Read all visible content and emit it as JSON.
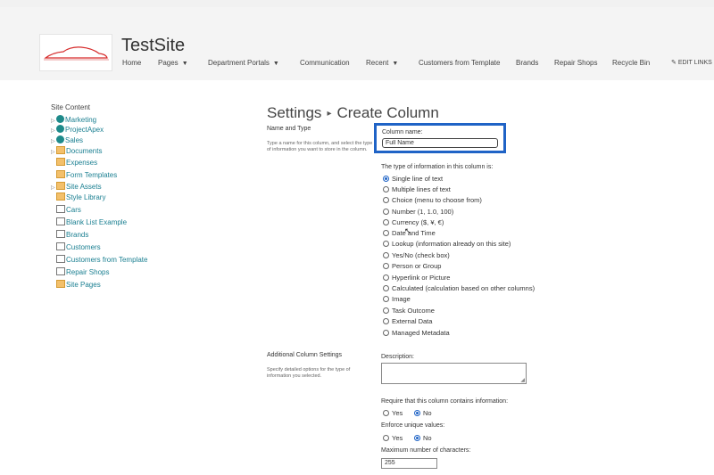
{
  "site": {
    "title": "TestSite"
  },
  "topnav": {
    "items": [
      {
        "label": "Home"
      },
      {
        "label": "Pages",
        "caret": "▼"
      },
      {
        "label": "Department Portals",
        "caret": "▼"
      },
      {
        "label": "Communication"
      },
      {
        "label": "Recent",
        "caret": "▼"
      },
      {
        "label": "Customers from Template"
      },
      {
        "label": "Brands"
      },
      {
        "label": "Repair Shops"
      },
      {
        "label": "Recycle Bin"
      }
    ],
    "edit_links": "EDIT LINKS"
  },
  "leftnav": {
    "heading": "Site Content",
    "items": [
      {
        "label": "Marketing",
        "icon": "site-icon"
      },
      {
        "label": "ProjectApex",
        "icon": "site-icon"
      },
      {
        "label": "Sales",
        "icon": "site-icon"
      },
      {
        "label": "Documents",
        "icon": "library-icon"
      },
      {
        "label": "Expenses",
        "icon": "library-icon"
      },
      {
        "label": "Form Templates",
        "icon": "library-icon"
      },
      {
        "label": "Site Assets",
        "icon": "library-icon"
      },
      {
        "label": "Style Library",
        "icon": "library-icon"
      },
      {
        "label": "Cars",
        "icon": "list-icon"
      },
      {
        "label": "Blank List Example",
        "icon": "list-icon"
      },
      {
        "label": "Brands",
        "icon": "list-icon"
      },
      {
        "label": "Customers",
        "icon": "list-icon"
      },
      {
        "label": "Customers from Template",
        "icon": "list-icon"
      },
      {
        "label": "Repair Shops",
        "icon": "list-icon"
      },
      {
        "label": "Site Pages",
        "icon": "library-icon"
      }
    ]
  },
  "page": {
    "breadcrumb_root": "Settings",
    "breadcrumb_sep": "▸",
    "title": "Create Column"
  },
  "name_type": {
    "heading": "Name and Type",
    "description": "Type a name for this column, and select the type of information you want to store in the column.",
    "column_name_label": "Column name:",
    "column_name_value": "Full Name",
    "type_label": "The type of information in this column is:",
    "types": [
      "Single line of text",
      "Multiple lines of text",
      "Choice (menu to choose from)",
      "Number (1, 1.0, 100)",
      "Currency ($, ¥, €)",
      "Date and Time",
      "Lookup (information already on this site)",
      "Yes/No (check box)",
      "Person or Group",
      "Hyperlink or Picture",
      "Calculated (calculation based on other columns)",
      "Image",
      "Task Outcome",
      "External Data",
      "Managed Metadata"
    ]
  },
  "additional": {
    "heading": "Additional Column Settings",
    "description": "Specify detailed options for the type of information you selected.",
    "description_label": "Description:",
    "require_label": "Require that this column contains information:",
    "enforce_label": "Enforce unique values:",
    "yes": "Yes",
    "no": "No",
    "max_chars_label": "Maximum number of characters:",
    "max_chars_value": "255"
  },
  "colors": {
    "accent": "#1f63c6",
    "link": "#1a7f91"
  }
}
